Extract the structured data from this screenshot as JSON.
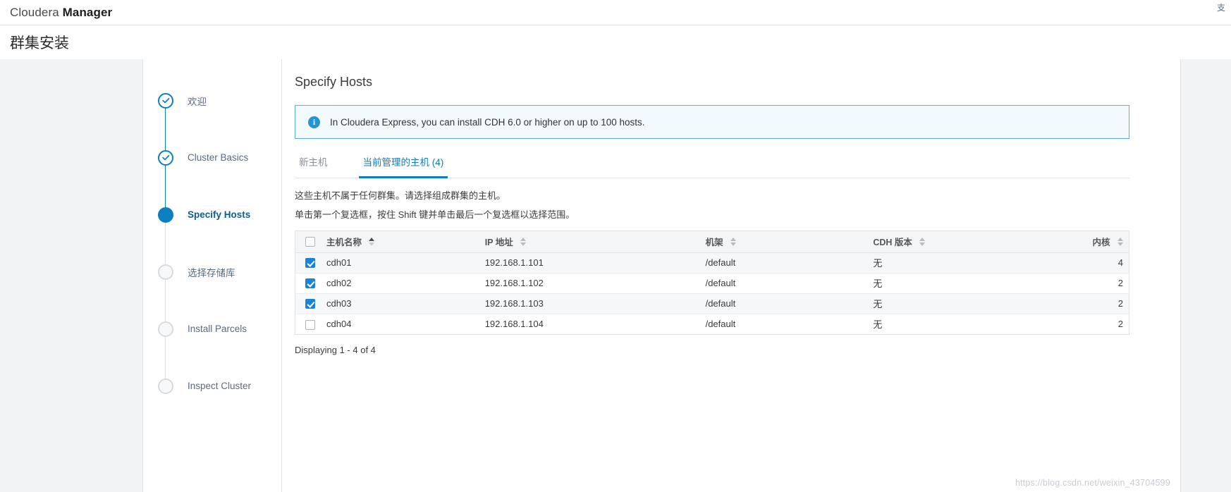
{
  "appbar": {
    "brand_prefix": "Cloudera ",
    "brand_strong": "Manager",
    "right_clipped": "支"
  },
  "page": {
    "title": "群集安装"
  },
  "wizard": {
    "steps": [
      {
        "label": "欢迎",
        "state": "done"
      },
      {
        "label": "Cluster Basics",
        "state": "done"
      },
      {
        "label": "Specify Hosts",
        "state": "current"
      },
      {
        "label": "选择存储库",
        "state": "todo"
      },
      {
        "label": "Install Parcels",
        "state": "todo"
      },
      {
        "label": "Inspect Cluster",
        "state": "todo"
      }
    ]
  },
  "main": {
    "panel_title": "Specify Hosts",
    "notice": {
      "icon": "info-icon",
      "glyph": "i",
      "text": "In Cloudera Express, you can install CDH 6.0 or higher on up to 100 hosts.",
      "border_color": "#57b4dd",
      "background": "#f2fafd",
      "icon_color": "#2196d3"
    },
    "tabs": [
      {
        "label": "新主机",
        "active": false
      },
      {
        "label": "当前管理的主机 (4)",
        "active": true
      }
    ],
    "hints": [
      "这些主机不属于任何群集。请选择组成群集的主机。",
      "单击第一个复选框，按住 Shift 键并单击最后一个复选框以选择范围。"
    ],
    "table": {
      "select_all_checked": false,
      "columns": [
        {
          "label": "主机名称",
          "sort": "asc",
          "align": "left"
        },
        {
          "label": "IP 地址",
          "sort": "none",
          "align": "left"
        },
        {
          "label": "机架",
          "sort": "none",
          "align": "left"
        },
        {
          "label": "CDH 版本",
          "sort": "none",
          "align": "left"
        },
        {
          "label": "内核",
          "sort": "none",
          "align": "right"
        }
      ],
      "rows": [
        {
          "checked": true,
          "hostname": "cdh01",
          "ip": "192.168.1.101",
          "rack": "/default",
          "cdh_version": "无",
          "cores": "4"
        },
        {
          "checked": true,
          "hostname": "cdh02",
          "ip": "192.168.1.102",
          "rack": "/default",
          "cdh_version": "无",
          "cores": "2"
        },
        {
          "checked": true,
          "hostname": "cdh03",
          "ip": "192.168.1.103",
          "rack": "/default",
          "cdh_version": "无",
          "cores": "2"
        },
        {
          "checked": false,
          "hostname": "cdh04",
          "ip": "192.168.1.104",
          "rack": "/default",
          "cdh_version": "无",
          "cores": "2"
        }
      ]
    },
    "displaying": "Displaying 1 - 4 of 4"
  },
  "watermark": "https://blog.csdn.net/weixin_43704599",
  "colors": {
    "accent": "#0b7fc0",
    "accent_dark": "#0b5d92",
    "checkbox": "#1a82d8",
    "gutter": "#f2f3f5"
  }
}
